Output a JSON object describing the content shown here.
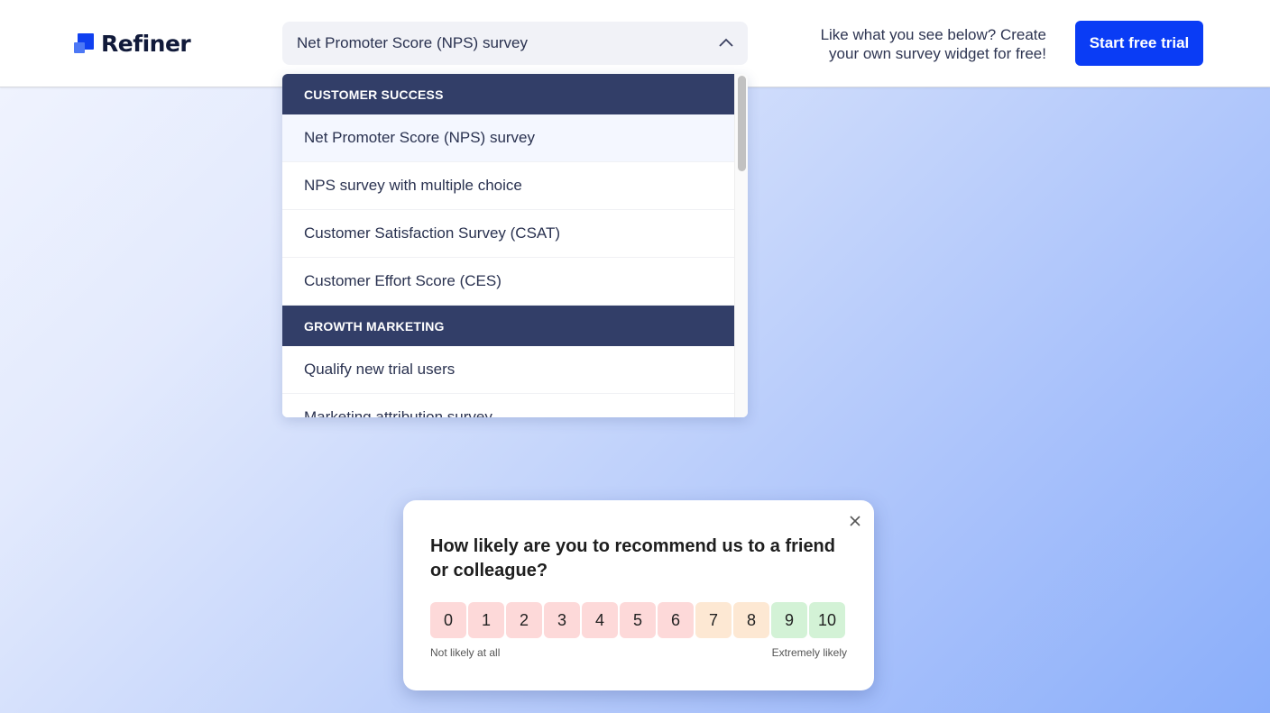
{
  "header": {
    "brand": "Refiner",
    "select": {
      "value": "Net Promoter Score (NPS) survey"
    },
    "cta_text": "Like what you see below? Create your own survey widget for free!",
    "cta_button": "Start free trial",
    "accent_color": "#0a3cf5"
  },
  "dropdown": {
    "groups": [
      {
        "label": "CUSTOMER SUCCESS",
        "options": [
          {
            "label": "Net Promoter Score (NPS) survey",
            "selected": true
          },
          {
            "label": "NPS survey with multiple choice"
          },
          {
            "label": "Customer Satisfaction Survey (CSAT)"
          },
          {
            "label": "Customer Effort Score (CES)"
          }
        ]
      },
      {
        "label": "GROWTH MARKETING",
        "options": [
          {
            "label": "Qualify new trial users"
          },
          {
            "label": "Marketing attribution survey"
          }
        ]
      }
    ]
  },
  "survey": {
    "question": "How likely are you to recommend us to a friend or colleague?",
    "scale": [
      {
        "value": "0",
        "color": "#fdd9d9"
      },
      {
        "value": "1",
        "color": "#fdd9d9"
      },
      {
        "value": "2",
        "color": "#fdd9d9"
      },
      {
        "value": "3",
        "color": "#fdd9d9"
      },
      {
        "value": "4",
        "color": "#fdd9d9"
      },
      {
        "value": "5",
        "color": "#fdd9d9"
      },
      {
        "value": "6",
        "color": "#fdd9d9"
      },
      {
        "value": "7",
        "color": "#fde8d3"
      },
      {
        "value": "8",
        "color": "#fde8d3"
      },
      {
        "value": "9",
        "color": "#d3f2d6"
      },
      {
        "value": "10",
        "color": "#d3f2d6"
      }
    ],
    "label_low": "Not likely at all",
    "label_high": "Extremely likely"
  }
}
